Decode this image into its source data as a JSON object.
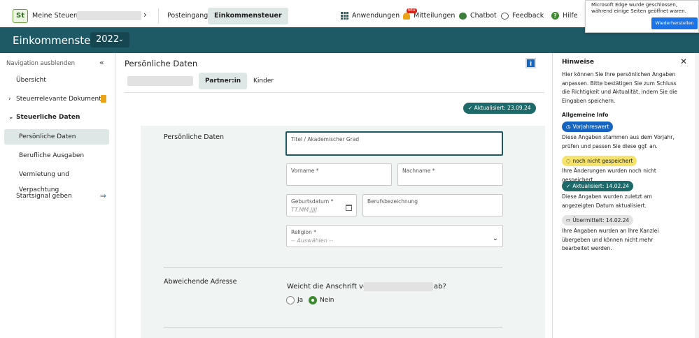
{
  "topbar": {
    "logo_text": "St",
    "brand_label": "Meine Steuern",
    "nav": [
      {
        "label": "Posteingang"
      },
      {
        "label": "Einkommensteuer"
      }
    ],
    "items": {
      "apps": "Anwendungen",
      "messages": "Mitteilungen",
      "messages_badge": "NEU",
      "chatbot": "Chatbot",
      "feedback": "Feedback",
      "help": "Hilfe"
    }
  },
  "notification": {
    "text": "Microsoft Edge wurde geschlossen, während einige Seiten geöffnet waren.",
    "button": "Wiederherstellen"
  },
  "header": {
    "title": "Einkommensteuer",
    "year": "2022"
  },
  "sidebar": {
    "hide_label": "Navigation ausblenden",
    "items": [
      {
        "label": "Übersicht"
      },
      {
        "label": "Steuerrelevante Dokumente"
      },
      {
        "label": "Steuerliche Daten"
      },
      {
        "label": "Persönliche Daten"
      },
      {
        "label": "Berufliche Ausgaben"
      },
      {
        "label": "Vermietung und Verpachtung"
      },
      {
        "label": "Startsignal geben"
      }
    ]
  },
  "main": {
    "title": "Persönliche Daten",
    "info_icon": "i",
    "tabs": [
      {
        "label": "Partner:in"
      },
      {
        "label": "Kinder"
      }
    ],
    "updated_badge": "Aktualisiert: 23.09.24",
    "section_personal": "Persönliche Daten",
    "fields": {
      "title": {
        "label": "Titel / Akademischer Grad"
      },
      "firstname": {
        "label": "Vorname *"
      },
      "lastname": {
        "label": "Nachname *"
      },
      "birthdate": {
        "label": "Geburtsdatum *",
        "placeholder": "TT.MM.JJJJ"
      },
      "profession": {
        "label": "Berufsbezeichnung"
      },
      "religion": {
        "label": "Religion *",
        "value": "-- Auswählen --"
      }
    },
    "section_address": "Abweichende Adresse",
    "question_prefix": "Weicht die Anschrift von",
    "question_suffix": "ab?",
    "radio_yes": "Ja",
    "radio_no": "Nein"
  },
  "hints": {
    "title": "Hinweise",
    "intro": "Hier können Sie Ihre persönlichen Angaben anpassen. Bitte bestätigen Sie zum Schluss die Richtigkeit und Aktualität, indem Sie die Eingaben speichern.",
    "general_info": "Allgemeine Info",
    "previous_value": {
      "label": "Vorjahreswert",
      "text": "Diese Angaben stammen aus dem Vorjahr, prüfen und passen Sie diese ggf. an."
    },
    "not_saved": {
      "label": "noch nicht gespeichert",
      "text": "Ihre Änderungen wurden noch nicht gespeichert."
    },
    "updated": {
      "label": "Aktualisiert: 14.02.24",
      "text": "Diese Angaben wurden zuletzt am angezeigten Datum aktualisiert."
    },
    "transmitted": {
      "label": "Übermittelt: 14.02.24",
      "text": "Ihre Angaben wurden an Ihre Kanzlei übergeben und können nicht mehr bearbeitet werden."
    }
  }
}
